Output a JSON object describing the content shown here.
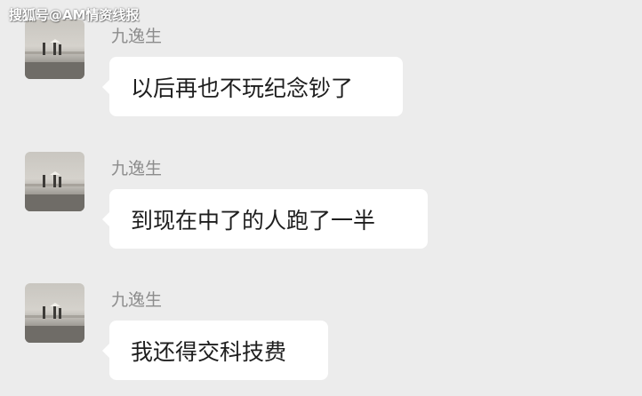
{
  "watermark": "搜狐号@AM情资线报",
  "messages": [
    {
      "sender": "九逸生",
      "text": "以后再也不玩纪念钞了",
      "avatar_icon": "avatar-beach-figures"
    },
    {
      "sender": "九逸生",
      "text": "到现在中了的人跑了一半",
      "avatar_icon": "avatar-beach-figures"
    },
    {
      "sender": "九逸生",
      "text": "我还得交科技费",
      "avatar_icon": "avatar-beach-figures"
    }
  ],
  "colors": {
    "background": "#ececec",
    "bubble": "#ffffff",
    "nickname": "#8c8c8c",
    "message_text": "#1e1e1e"
  }
}
